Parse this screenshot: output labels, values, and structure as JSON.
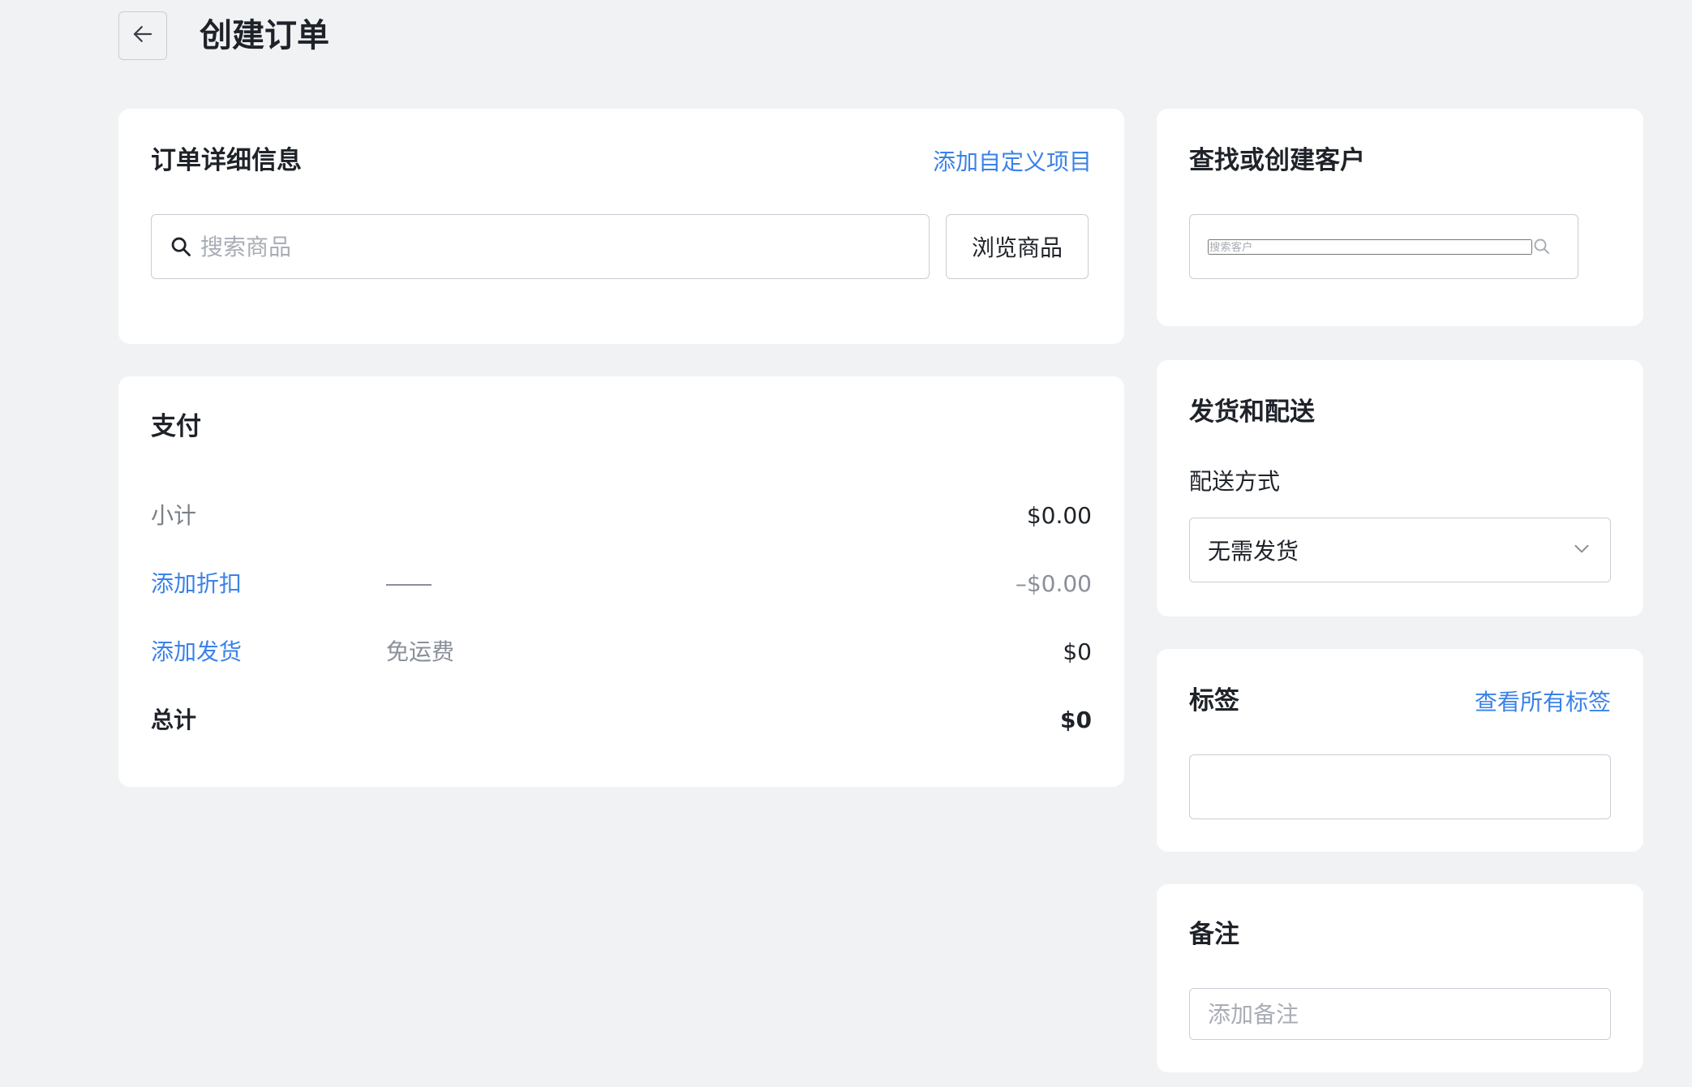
{
  "header": {
    "title": "创建订单"
  },
  "order_details": {
    "title": "订单详细信息",
    "add_custom_link": "添加自定义项目",
    "search_placeholder": "搜索商品",
    "browse_button": "浏览商品"
  },
  "payment": {
    "title": "支付",
    "subtotal_label": "小计",
    "subtotal_value": "$0.00",
    "discount_label": "添加折扣",
    "discount_value": "–$0.00",
    "shipping_label": "添加发货",
    "shipping_note": "免运费",
    "shipping_value": "$0",
    "total_label": "总计",
    "total_value": "$0"
  },
  "customer": {
    "title": "查找或创建客户",
    "search_placeholder": "搜索客户"
  },
  "shipping": {
    "title": "发货和配送",
    "method_label": "配送方式",
    "method_value": "无需发货"
  },
  "tags": {
    "title": "标签",
    "view_all_link": "查看所有标签",
    "input_value": ""
  },
  "notes": {
    "title": "备注",
    "placeholder": "添加备注"
  },
  "colors": {
    "link": "#3b82e8",
    "background": "#f1f2f4",
    "card": "#ffffff",
    "border": "#c9cdd4"
  }
}
